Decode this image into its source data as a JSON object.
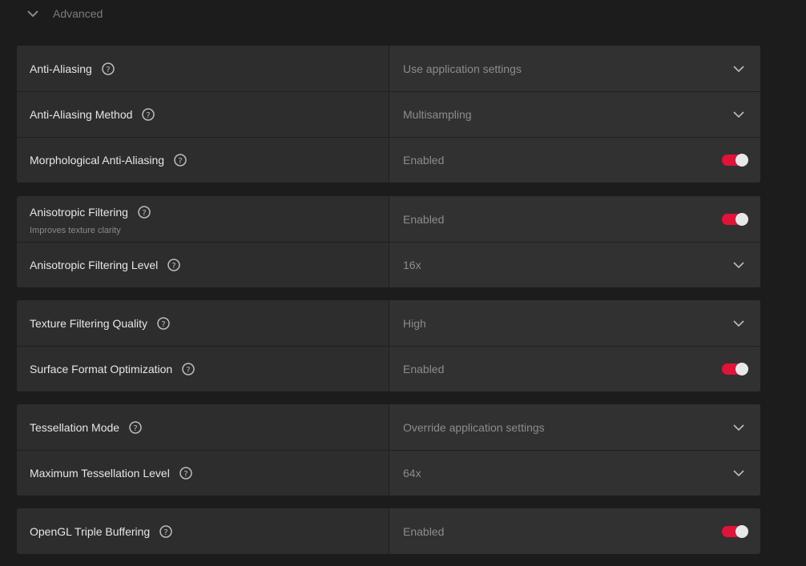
{
  "section": {
    "title": "Advanced",
    "expanded": true,
    "icon": "chevron-down-icon"
  },
  "colors": {
    "accent": "#e0133b",
    "background": "#1c1c1c",
    "panel": "#2d2d2d"
  },
  "groups": [
    {
      "rows": [
        {
          "label": "Anti-Aliasing",
          "control": "dropdown",
          "value": "Use application settings"
        },
        {
          "label": "Anti-Aliasing Method",
          "control": "dropdown",
          "value": "Multisampling"
        },
        {
          "label": "Morphological Anti-Aliasing",
          "control": "toggle",
          "value": "Enabled",
          "on": true
        }
      ]
    },
    {
      "rows": [
        {
          "label": "Anisotropic Filtering",
          "sublabel": "Improves texture clarity",
          "control": "toggle",
          "value": "Enabled",
          "on": true
        },
        {
          "label": "Anisotropic Filtering Level",
          "control": "dropdown",
          "value": "16x"
        }
      ]
    },
    {
      "rows": [
        {
          "label": "Texture Filtering Quality",
          "control": "dropdown",
          "value": "High"
        },
        {
          "label": "Surface Format Optimization",
          "control": "toggle",
          "value": "Enabled",
          "on": true
        }
      ]
    },
    {
      "rows": [
        {
          "label": "Tessellation Mode",
          "control": "dropdown",
          "value": "Override application settings"
        },
        {
          "label": "Maximum Tessellation Level",
          "control": "dropdown",
          "value": "64x"
        }
      ]
    },
    {
      "rows": [
        {
          "label": "OpenGL Triple Buffering",
          "control": "toggle",
          "value": "Enabled",
          "on": true
        }
      ]
    }
  ]
}
